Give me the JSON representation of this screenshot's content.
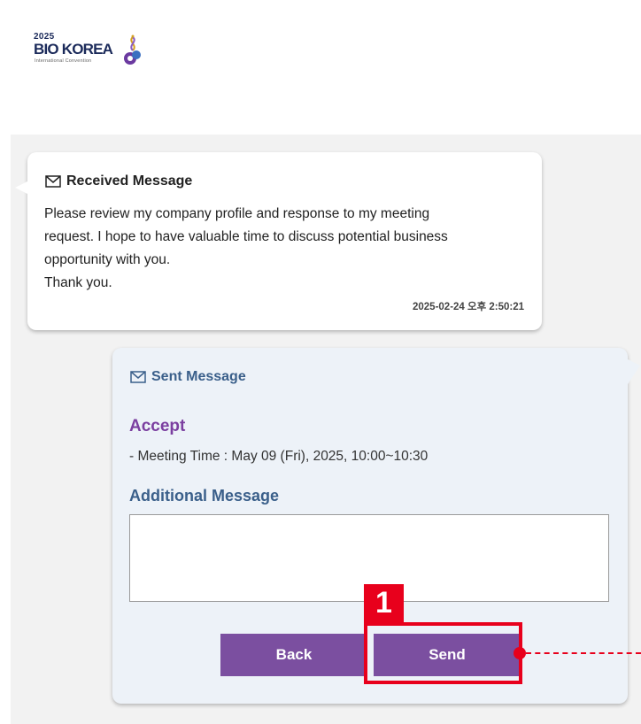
{
  "logo": {
    "year": "2025",
    "name": "BIO KOREA",
    "subtitle": "International Convention"
  },
  "received": {
    "header": "Received Message",
    "icon": "envelope-icon",
    "body_lines": [
      "Please review my company profile and response to my meeting",
      "request. I hope to have valuable time to discuss potential business",
      "opportunity with you.",
      "Thank you."
    ],
    "timestamp": "2025-02-24 오후 2:50:21"
  },
  "sent": {
    "header": "Sent Message",
    "icon": "envelope-icon",
    "status": "Accept",
    "meeting_time": "- Meeting Time : May 09 (Fri), 2025, 10:00~10:30",
    "additional_label": "Additional Message",
    "additional_value": "",
    "back_label": "Back",
    "send_label": "Send"
  },
  "annotation": {
    "step_number": "1"
  },
  "colors": {
    "accent_purple": "#7b4fa0",
    "accept_purple": "#7b3fa0",
    "heading_blue": "#3a5f8a",
    "highlight_red": "#e8001c",
    "sent_bubble_bg": "#edf2f8",
    "panel_bg": "#f2f2f2"
  }
}
